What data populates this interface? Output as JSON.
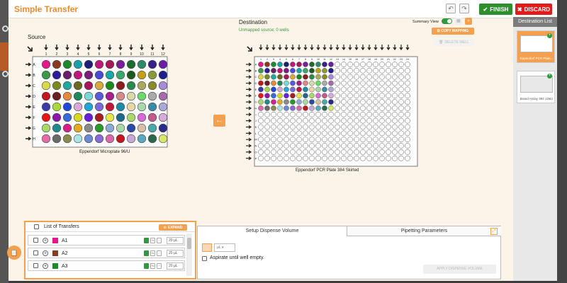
{
  "title": "Simple Transfer",
  "finish_label": "FINISH",
  "discard_label": "DISCARD",
  "source": {
    "label": "Source",
    "plate_name": "Eppendorf Microplate 96/U",
    "rows": [
      "A",
      "B",
      "C",
      "D",
      "E",
      "F",
      "G",
      "H"
    ],
    "cols": [
      "1",
      "2",
      "3",
      "4",
      "5",
      "6",
      "7",
      "8",
      "9",
      "10",
      "11",
      "12"
    ],
    "wells": [
      [
        "#e6178a",
        "#8a3a1e",
        "#1e8a2a",
        "#1aa0a8",
        "#1e1e7a",
        "#c2177a",
        "#a8175a",
        "#7a1e9a",
        "#1e6a2a",
        "#2a8a6a",
        "#3a1e8a",
        "#6a1ea8"
      ],
      [
        "#3a9a4a",
        "#2a1e9a",
        "#6a1e6a",
        "#c2177a",
        "#7a1e7a",
        "#4a4ad8",
        "#17a8a8",
        "#3aa86a",
        "#1e5a1e",
        "#c2a017",
        "#8a9a3a",
        "#1e1e8a"
      ],
      [
        "#d8d84a",
        "#7a8a1e",
        "#1ea8a0",
        "#6a6a1e",
        "#a8175a",
        "#d8a83a",
        "#1e8a1e",
        "#8a1e1e",
        "#2a8a4a",
        "#aaaa5a",
        "#8a8a2a",
        "#a88ad8"
      ],
      [
        "#c2171e",
        "#6a1e1e",
        "#e68a3a",
        "#1e8a5a",
        "#7ad8d8",
        "#5a5ad8",
        "#a81e8a",
        "#d88a8a",
        "#d8d8a8",
        "#6ad86a",
        "#aaaaaa",
        "#a86aa8"
      ],
      [
        "#3a3aa8",
        "#a8d83a",
        "#1e4ad8",
        "#d8a8d8",
        "#1ea8d8",
        "#7a6ad8",
        "#c2173a",
        "#1e8aa8",
        "#e6d8a8",
        "#aad8a8",
        "#3a8aa8",
        "#aaaad8"
      ],
      [
        "#e61717",
        "#8a17a8",
        "#3a6ad8",
        "#d8d81e",
        "#6a1ed8",
        "#a81e1e",
        "#e6e64a",
        "#1e6a8a",
        "#aad86a",
        "#d86ad8",
        "#c25a8a",
        "#d8aad8"
      ],
      [
        "#a8d86a",
        "#1e8a8a",
        "#d81e8a",
        "#e6a81e",
        "#8a8a8a",
        "#2a9a2a",
        "#8aaad8",
        "#a8d8a8",
        "#2a4aa8",
        "#d8c0a8",
        "#4aa8a8",
        "#2a2a8a"
      ],
      [
        "#e66aa8",
        "#6a6a6a",
        "#8a8a4a",
        "#a8e6e6",
        "#6a8ad8",
        "#8a6ad8",
        "#d86aa8",
        "#c2171e",
        "#c8a8d8",
        "#5aa8c2",
        "#2a6a4a",
        "#d8e66a"
      ]
    ]
  },
  "destination": {
    "label": "Destination",
    "unmapped_text": "Unmapped source: 0 wells",
    "summary_label": "Summary View",
    "copy_mapping_label": "COPY MAPPING",
    "delete_wells_label": "DELETE WELL",
    "plate_name": "Eppendorf PCR Plate 384 Skirted",
    "rows": [
      "A",
      "B",
      "C",
      "D",
      "E",
      "F",
      "G",
      "H",
      "I",
      "J",
      "K",
      "L",
      "M",
      "N",
      "O",
      "P"
    ],
    "cols": [
      "1",
      "2",
      "3",
      "4",
      "5",
      "6",
      "7",
      "8",
      "9",
      "10",
      "11",
      "12",
      "13",
      "14",
      "15",
      "16",
      "17",
      "18",
      "19",
      "20",
      "21",
      "22",
      "23",
      "24"
    ],
    "filled_rows": 8,
    "filled_cols": 12
  },
  "dest_list": {
    "title": "Destination List",
    "items": [
      {
        "name": "Eppendorf PCR Plate..."
      },
      {
        "name": "Brand Assay 384 12&U"
      }
    ]
  },
  "transfers": {
    "title": "List of Transfers",
    "expand_label": "EXPAND",
    "items": [
      {
        "well": "A1",
        "color": "#e6178a",
        "volume": "20 µL"
      },
      {
        "well": "A2",
        "color": "#8a3a1e",
        "volume": "20 µL"
      },
      {
        "well": "A3",
        "color": "#1e8a2a",
        "volume": "20 µL"
      }
    ]
  },
  "settings": {
    "tab_setup": "Setup Dispense Volume",
    "tab_pipetting": "Pipetting Parameters",
    "unit": "µL",
    "aspirate_label": "Aspirate until well empty.",
    "apply_label": "APPLY DISPENSE VOLUME"
  }
}
